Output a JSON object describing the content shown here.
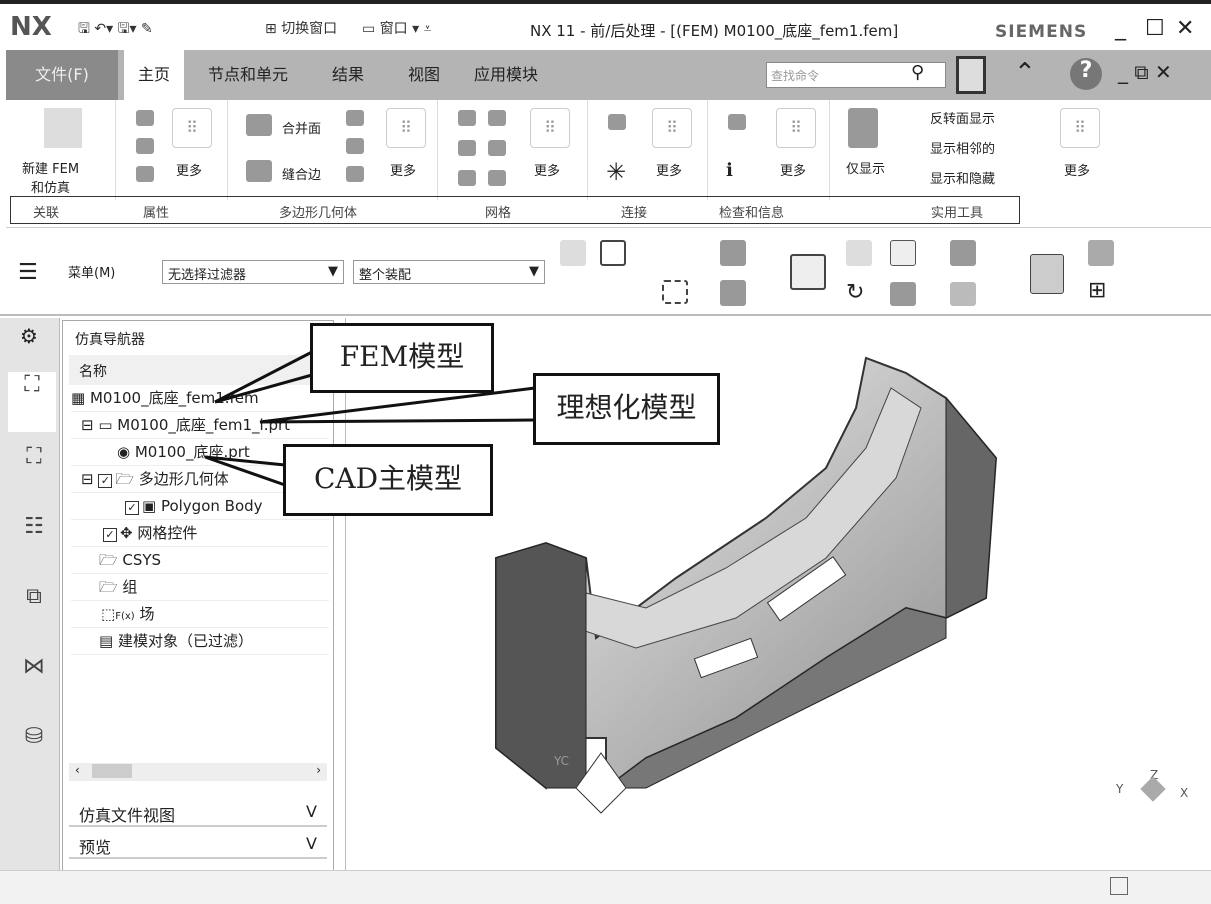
{
  "titlebar": {
    "logo": "NX",
    "switch_window": "切换窗口",
    "window": "窗口",
    "title": "NX 11 - 前/后处理 - [(FEM) M0100_底座_fem1.fem]",
    "brand": "SIEMENS"
  },
  "tabs": [
    {
      "label": "文件(F)"
    },
    {
      "label": "主页"
    },
    {
      "label": "节点和单元"
    },
    {
      "label": "结果"
    },
    {
      "label": "视图"
    },
    {
      "label": "应用模块"
    }
  ],
  "search": {
    "placeholder": "查找命令"
  },
  "ribbon": {
    "new_fem": "新建 FEM\n和仿真",
    "more": "更多",
    "merge_face": "合并面",
    "stitch_edge": "缝合边",
    "show_only": "仅显示",
    "reverse_face": "反转面显示",
    "show_adjacent": "显示相邻的",
    "show_hide": "显示和隐藏"
  },
  "groups": [
    "关联",
    "属性",
    "多边形几何体",
    "网格",
    "连接",
    "检查和信息",
    "实用工具"
  ],
  "toolbar": {
    "menu": "菜单(M)",
    "filter": "无选择过滤器",
    "scope": "整个装配"
  },
  "navigator": {
    "title": "仿真导航器",
    "column": "名称",
    "items": [
      "M0100_底座_fem1.fem",
      "M0100_底座_fem1_i.prt",
      "M0100_底座.prt",
      "多边形几何体",
      "Polygon Body",
      "网格控件",
      "CSYS",
      "组",
      "场",
      "建模对象（已过滤）"
    ],
    "field_prefix": "F(x)",
    "panels": [
      "仿真文件视图",
      "预览"
    ]
  },
  "callouts": {
    "fem": "FEM模型",
    "ideal": "理想化模型",
    "cad": "CAD主模型"
  },
  "triad": {
    "x": "X",
    "y": "Y",
    "z": "Z",
    "yc": "YC"
  }
}
